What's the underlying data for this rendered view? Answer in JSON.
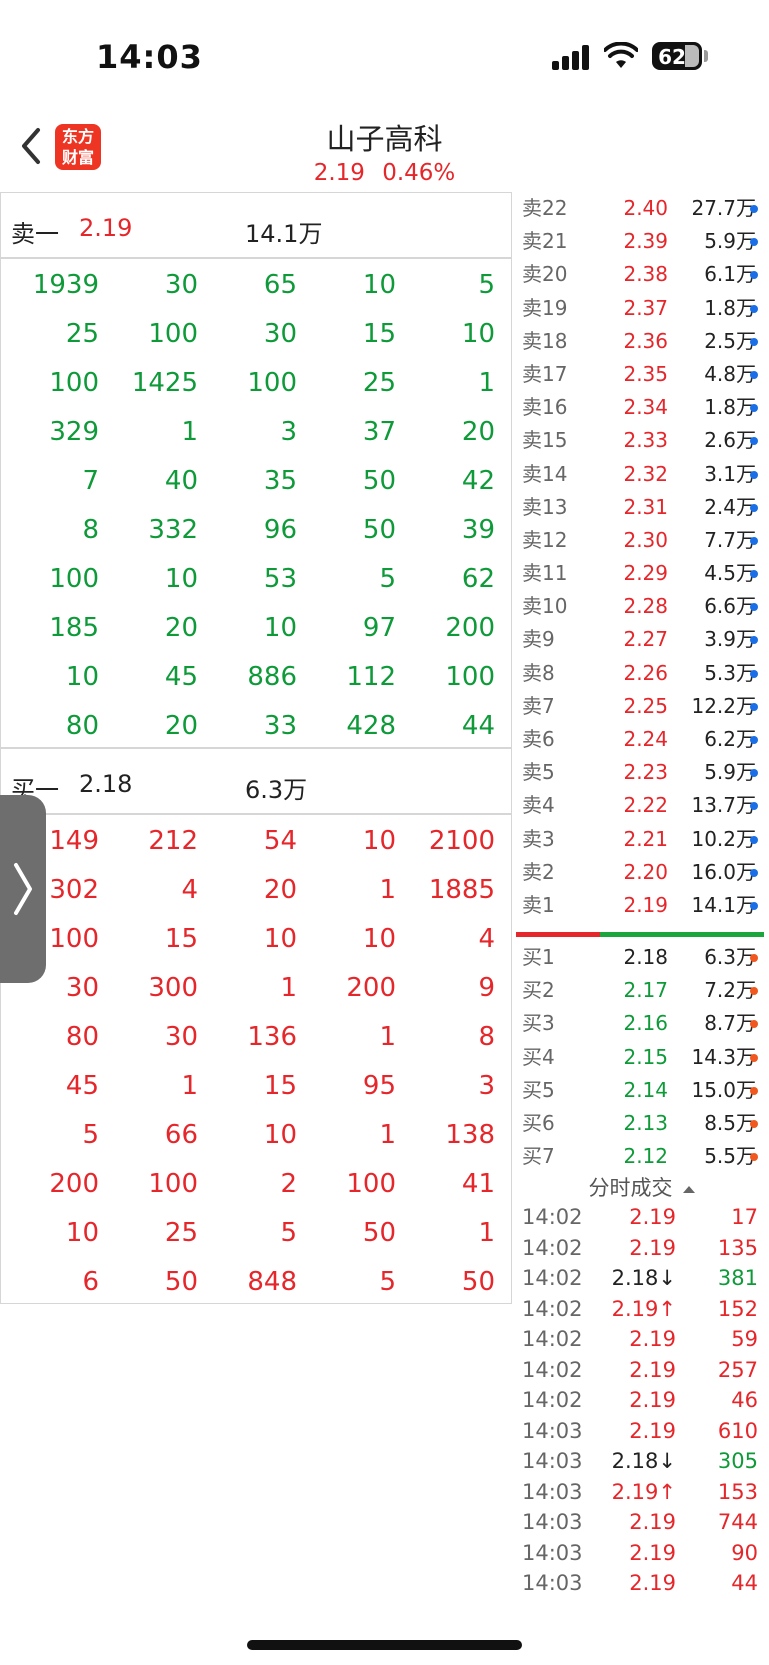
{
  "status_bar": {
    "time": "14:03",
    "battery": "62"
  },
  "header": {
    "brand_logo": "东方财富",
    "title": "山子高科",
    "price": "2.19",
    "change": "0.46%"
  },
  "left_panel": {
    "sell_label": "卖一",
    "sell_price": "2.19",
    "sell_volume": "14.1万",
    "sell_rows": [
      [
        "1939",
        "30",
        "65",
        "10",
        "5"
      ],
      [
        "25",
        "100",
        "30",
        "15",
        "10"
      ],
      [
        "100",
        "1425",
        "100",
        "25",
        "1"
      ],
      [
        "329",
        "1",
        "3",
        "37",
        "20"
      ],
      [
        "7",
        "40",
        "35",
        "50",
        "42"
      ],
      [
        "8",
        "332",
        "96",
        "50",
        "39"
      ],
      [
        "100",
        "10",
        "53",
        "5",
        "62"
      ],
      [
        "185",
        "20",
        "10",
        "97",
        "200"
      ],
      [
        "10",
        "45",
        "886",
        "112",
        "100"
      ],
      [
        "80",
        "20",
        "33",
        "428",
        "44"
      ]
    ],
    "buy_label": "买一",
    "buy_price": "2.18",
    "buy_volume": "6.3万",
    "buy_rows": [
      [
        "149",
        "212",
        "54",
        "10",
        "2100"
      ],
      [
        "302",
        "4",
        "20",
        "1",
        "1885"
      ],
      [
        "100",
        "15",
        "10",
        "10",
        "4"
      ],
      [
        "30",
        "300",
        "1",
        "200",
        "9"
      ],
      [
        "80",
        "30",
        "136",
        "1",
        "8"
      ],
      [
        "45",
        "1",
        "15",
        "95",
        "3"
      ],
      [
        "5",
        "66",
        "10",
        "1",
        "138"
      ],
      [
        "200",
        "100",
        "2",
        "100",
        "41"
      ],
      [
        "10",
        "25",
        "5",
        "50",
        "1"
      ],
      [
        "6",
        "50",
        "848",
        "5",
        "50"
      ]
    ]
  },
  "order_book": {
    "asks": [
      {
        "label": "卖22",
        "price": "2.40",
        "vol": "27.7万"
      },
      {
        "label": "卖21",
        "price": "2.39",
        "vol": "5.9万"
      },
      {
        "label": "卖20",
        "price": "2.38",
        "vol": "6.1万"
      },
      {
        "label": "卖19",
        "price": "2.37",
        "vol": "1.8万"
      },
      {
        "label": "卖18",
        "price": "2.36",
        "vol": "2.5万"
      },
      {
        "label": "卖17",
        "price": "2.35",
        "vol": "4.8万"
      },
      {
        "label": "卖16",
        "price": "2.34",
        "vol": "1.8万"
      },
      {
        "label": "卖15",
        "price": "2.33",
        "vol": "2.6万"
      },
      {
        "label": "卖14",
        "price": "2.32",
        "vol": "3.1万"
      },
      {
        "label": "卖13",
        "price": "2.31",
        "vol": "2.4万"
      },
      {
        "label": "卖12",
        "price": "2.30",
        "vol": "7.7万"
      },
      {
        "label": "卖11",
        "price": "2.29",
        "vol": "4.5万"
      },
      {
        "label": "卖10",
        "price": "2.28",
        "vol": "6.6万"
      },
      {
        "label": "卖9",
        "price": "2.27",
        "vol": "3.9万"
      },
      {
        "label": "卖8",
        "price": "2.26",
        "vol": "5.3万"
      },
      {
        "label": "卖7",
        "price": "2.25",
        "vol": "12.2万"
      },
      {
        "label": "卖6",
        "price": "2.24",
        "vol": "6.2万"
      },
      {
        "label": "卖5",
        "price": "2.23",
        "vol": "5.9万"
      },
      {
        "label": "卖4",
        "price": "2.22",
        "vol": "13.7万"
      },
      {
        "label": "卖3",
        "price": "2.21",
        "vol": "10.2万"
      },
      {
        "label": "卖2",
        "price": "2.20",
        "vol": "16.0万"
      },
      {
        "label": "卖1",
        "price": "2.19",
        "vol": "14.1万"
      }
    ],
    "bids": [
      {
        "label": "买1",
        "price": "2.18",
        "vol": "6.3万",
        "color": "black"
      },
      {
        "label": "买2",
        "price": "2.17",
        "vol": "7.2万",
        "color": "green"
      },
      {
        "label": "买3",
        "price": "2.16",
        "vol": "8.7万",
        "color": "green"
      },
      {
        "label": "买4",
        "price": "2.15",
        "vol": "14.3万",
        "color": "green"
      },
      {
        "label": "买5",
        "price": "2.14",
        "vol": "15.0万",
        "color": "green"
      },
      {
        "label": "买6",
        "price": "2.13",
        "vol": "8.5万",
        "color": "green"
      },
      {
        "label": "买7",
        "price": "2.12",
        "vol": "5.5万",
        "color": "green"
      }
    ]
  },
  "ticks": {
    "title": "分时成交",
    "rows": [
      {
        "time": "14:02",
        "price": "2.19",
        "vol": "17",
        "pc": "red",
        "vc": "red"
      },
      {
        "time": "14:02",
        "price": "2.19",
        "vol": "135",
        "pc": "red",
        "vc": "red"
      },
      {
        "time": "14:02",
        "price": "2.18↓",
        "vol": "381",
        "pc": "black",
        "vc": "green"
      },
      {
        "time": "14:02",
        "price": "2.19↑",
        "vol": "152",
        "pc": "red",
        "vc": "red"
      },
      {
        "time": "14:02",
        "price": "2.19",
        "vol": "59",
        "pc": "red",
        "vc": "red"
      },
      {
        "time": "14:02",
        "price": "2.19",
        "vol": "257",
        "pc": "red",
        "vc": "red"
      },
      {
        "time": "14:02",
        "price": "2.19",
        "vol": "46",
        "pc": "red",
        "vc": "red"
      },
      {
        "time": "14:03",
        "price": "2.19",
        "vol": "610",
        "pc": "red",
        "vc": "red"
      },
      {
        "time": "14:03",
        "price": "2.18↓",
        "vol": "305",
        "pc": "black",
        "vc": "green"
      },
      {
        "time": "14:03",
        "price": "2.19↑",
        "vol": "153",
        "pc": "red",
        "vc": "red"
      },
      {
        "time": "14:03",
        "price": "2.19",
        "vol": "744",
        "pc": "red",
        "vc": "red"
      },
      {
        "time": "14:03",
        "price": "2.19",
        "vol": "90",
        "pc": "red",
        "vc": "red"
      },
      {
        "time": "14:03",
        "price": "2.19",
        "vol": "44",
        "pc": "red",
        "vc": "red"
      }
    ]
  },
  "icons": {
    "back": "chevron-left-icon",
    "handle": "chevron-right-icon",
    "collapse": "caret-up-icon"
  }
}
